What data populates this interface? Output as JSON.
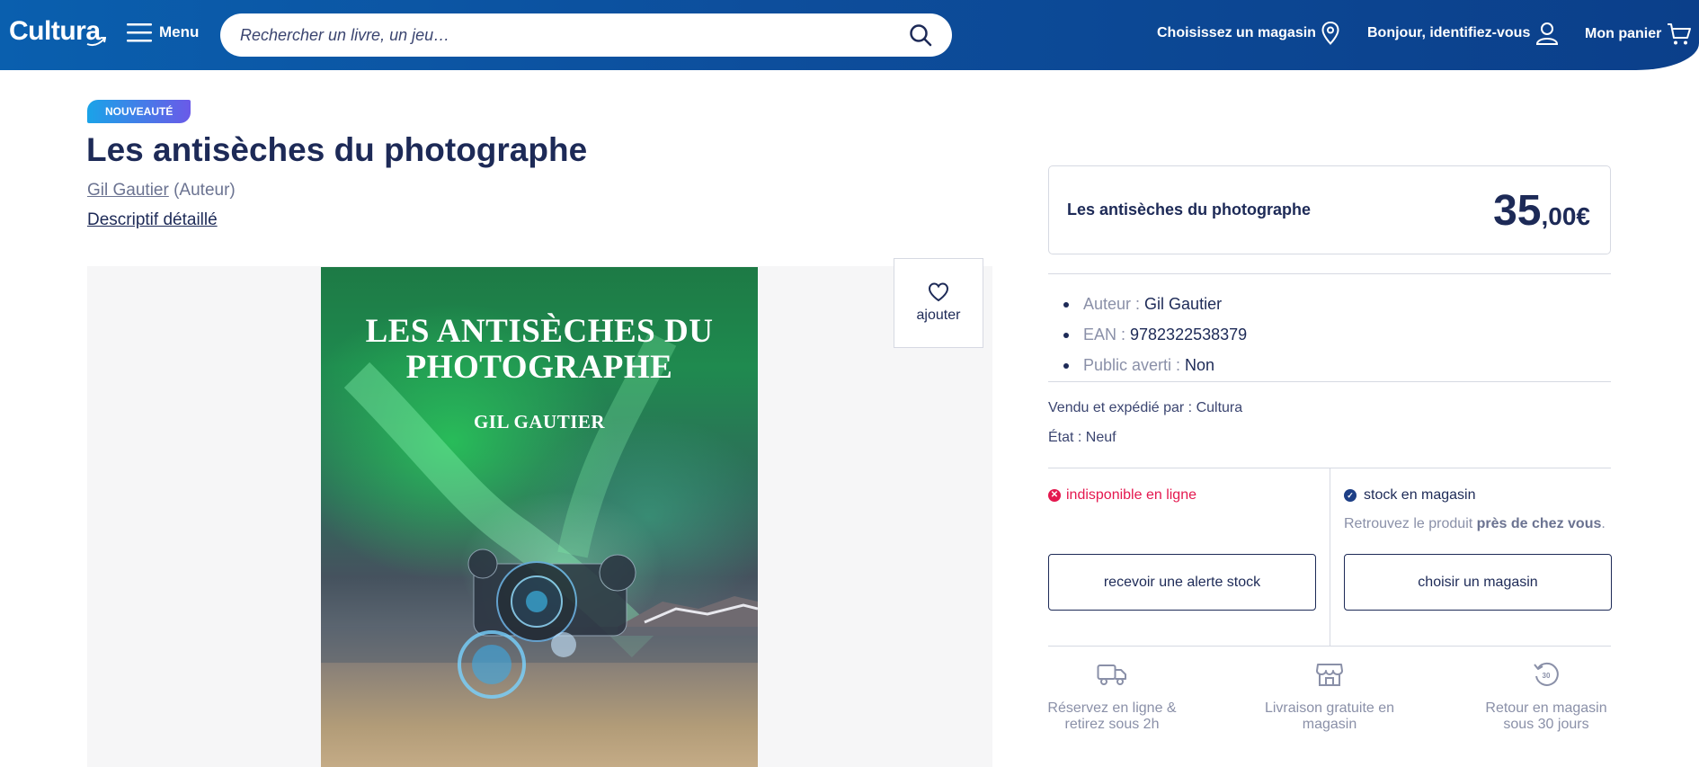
{
  "header": {
    "logo": "Cultura",
    "menu_label": "Menu",
    "search_placeholder": "Rechercher un livre, un jeu…",
    "store_label": "Choisissez un magasin",
    "account_label": "Bonjour, identifiez-vous",
    "cart_label": "Mon panier",
    "icons": [
      "hamburger-icon",
      "search-icon",
      "map-pin-icon",
      "user-icon",
      "cart-icon"
    ]
  },
  "product": {
    "badge": "NOUVEAUTÉ",
    "title": "Les antisèches du photographe",
    "author_name": "Gil Gautier",
    "author_role": "(Auteur)",
    "detail_link": "Descriptif détaillé",
    "cover": {
      "title": "LES ANTISÈCHES DU PHOTOGRAPHE",
      "author": "GIL GAUTIER"
    },
    "favorite_label": "ajouter"
  },
  "buybox": {
    "title": "Les antisèches du photographe",
    "price_int": "35",
    "price_dec": ",00€",
    "attributes": [
      {
        "label": "Auteur : ",
        "value": "Gil Gautier"
      },
      {
        "label": "EAN : ",
        "value": "9782322538379"
      },
      {
        "label": "Public averti : ",
        "value": "Non"
      }
    ],
    "sold_by": "Vendu et expédié par : Cultura",
    "state": "État : Neuf",
    "online_status": "indisponible en ligne",
    "store_status": "stock en magasin",
    "store_hint_prefix": "Retrouvez le produit ",
    "store_hint_bold": "près de chez vous",
    "store_hint_suffix": ".",
    "alert_button": "recevoir une alerte stock",
    "store_button": "choisir un magasin",
    "services": [
      {
        "line1": "Réservez en ligne &",
        "line2": "retirez sous 2h",
        "icon": "truck-icon"
      },
      {
        "line1": "Livraison gratuite en",
        "line2": "magasin",
        "icon": "store-icon"
      },
      {
        "line1": "Retour en magasin",
        "line2": "sous 30 jours",
        "icon": "return-30-icon"
      }
    ],
    "return_days_icon_text": "30"
  },
  "colors": {
    "header_blue": "#0b4f9e",
    "navy_text": "#1d2a57",
    "error_red": "#e4184f",
    "badge_gradient": [
      "#1aa3e8",
      "#6a5ae8"
    ]
  }
}
